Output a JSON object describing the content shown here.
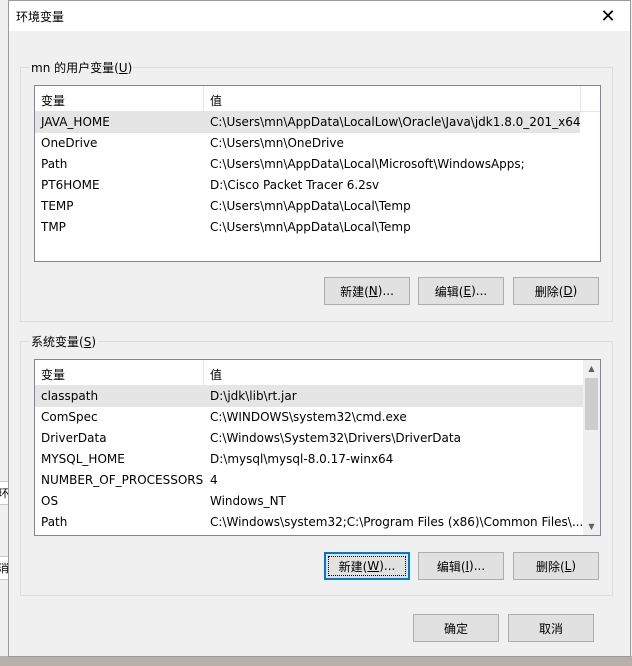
{
  "dialog": {
    "title": "环境变量",
    "close_glyph": "✕"
  },
  "user_vars": {
    "legend_prefix": "mn 的用户变量(",
    "legend_key": "U",
    "legend_suffix": ")",
    "columns": [
      "变量",
      "值"
    ],
    "rows": [
      {
        "name": "JAVA_HOME",
        "value": "C:\\Users\\mn\\AppData\\LocalLow\\Oracle\\Java\\jdk1.8.0_201_x64"
      },
      {
        "name": "OneDrive",
        "value": "C:\\Users\\mn\\OneDrive"
      },
      {
        "name": "Path",
        "value": "C:\\Users\\mn\\AppData\\Local\\Microsoft\\WindowsApps;"
      },
      {
        "name": "PT6HOME",
        "value": "D:\\Cisco Packet Tracer 6.2sv"
      },
      {
        "name": "TEMP",
        "value": "C:\\Users\\mn\\AppData\\Local\\Temp"
      },
      {
        "name": "TMP",
        "value": "C:\\Users\\mn\\AppData\\Local\\Temp"
      }
    ],
    "selected_index": 0,
    "buttons": {
      "new": {
        "prefix": "新建(",
        "key": "N",
        "suffix": ")..."
      },
      "edit": {
        "prefix": "编辑(",
        "key": "E",
        "suffix": ")..."
      },
      "delete": {
        "prefix": "删除(",
        "key": "D",
        "suffix": ")"
      }
    }
  },
  "system_vars": {
    "legend_prefix": "系统变量(",
    "legend_key": "S",
    "legend_suffix": ")",
    "columns": [
      "变量",
      "值"
    ],
    "rows": [
      {
        "name": "classpath",
        "value": "D:\\jdk\\lib\\rt.jar"
      },
      {
        "name": "ComSpec",
        "value": "C:\\WINDOWS\\system32\\cmd.exe"
      },
      {
        "name": "DriverData",
        "value": "C:\\Windows\\System32\\Drivers\\DriverData"
      },
      {
        "name": "MYSQL_HOME",
        "value": "D:\\mysql\\mysql-8.0.17-winx64"
      },
      {
        "name": "NUMBER_OF_PROCESSORS",
        "value": "4"
      },
      {
        "name": "OS",
        "value": "Windows_NT"
      },
      {
        "name": "Path",
        "value": "C:\\Windows\\system32;C:\\Program Files (x86)\\Common Files\\..."
      }
    ],
    "selected_index": 0,
    "buttons": {
      "new": {
        "prefix": "新建(",
        "key": "W",
        "suffix": ")..."
      },
      "edit": {
        "prefix": "编辑(",
        "key": "I",
        "suffix": ")..."
      },
      "delete": {
        "prefix": "删除(",
        "key": "L",
        "suffix": ")"
      }
    }
  },
  "footer": {
    "ok_label": "确定",
    "cancel_label": "取消"
  },
  "background": {
    "fragment_1": "环",
    "fragment_2": "消"
  }
}
